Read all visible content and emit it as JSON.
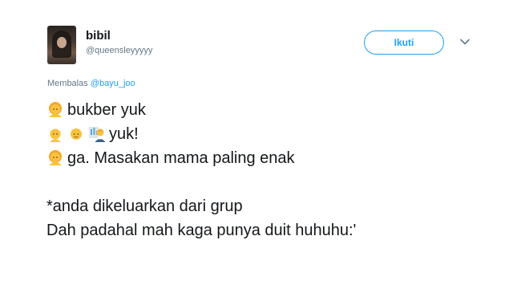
{
  "user": {
    "name": "bibil",
    "handle": "@queensleyyyyy"
  },
  "follow_label": "Ikuti",
  "reply": {
    "prefix": "Membalas",
    "mention": "@bayu_joo"
  },
  "lines": [
    {
      "emojis": [
        "woman-emoji"
      ],
      "text": "bukber yuk"
    },
    {
      "emojis": [
        "man-emoji",
        "boy-emoji",
        "office-worker-emoji"
      ],
      "text": "yuk!"
    },
    {
      "emojis": [
        "woman-emoji"
      ],
      "text": "ga. Masakan mama paling enak"
    },
    {
      "emojis": [],
      "text": ""
    },
    {
      "emojis": [],
      "text": "*anda dikeluarkan dari grup"
    },
    {
      "emojis": [],
      "text": "Dah padahal mah kaga punya duit huhuhu:'"
    }
  ],
  "colors": {
    "accent": "#1da1f2",
    "text": "#14171a",
    "muted": "#657786",
    "emoji_skin": "#f9c33d",
    "emoji_hair": "#f4a52a"
  },
  "icons": {
    "caret": "chevron-down-icon"
  }
}
